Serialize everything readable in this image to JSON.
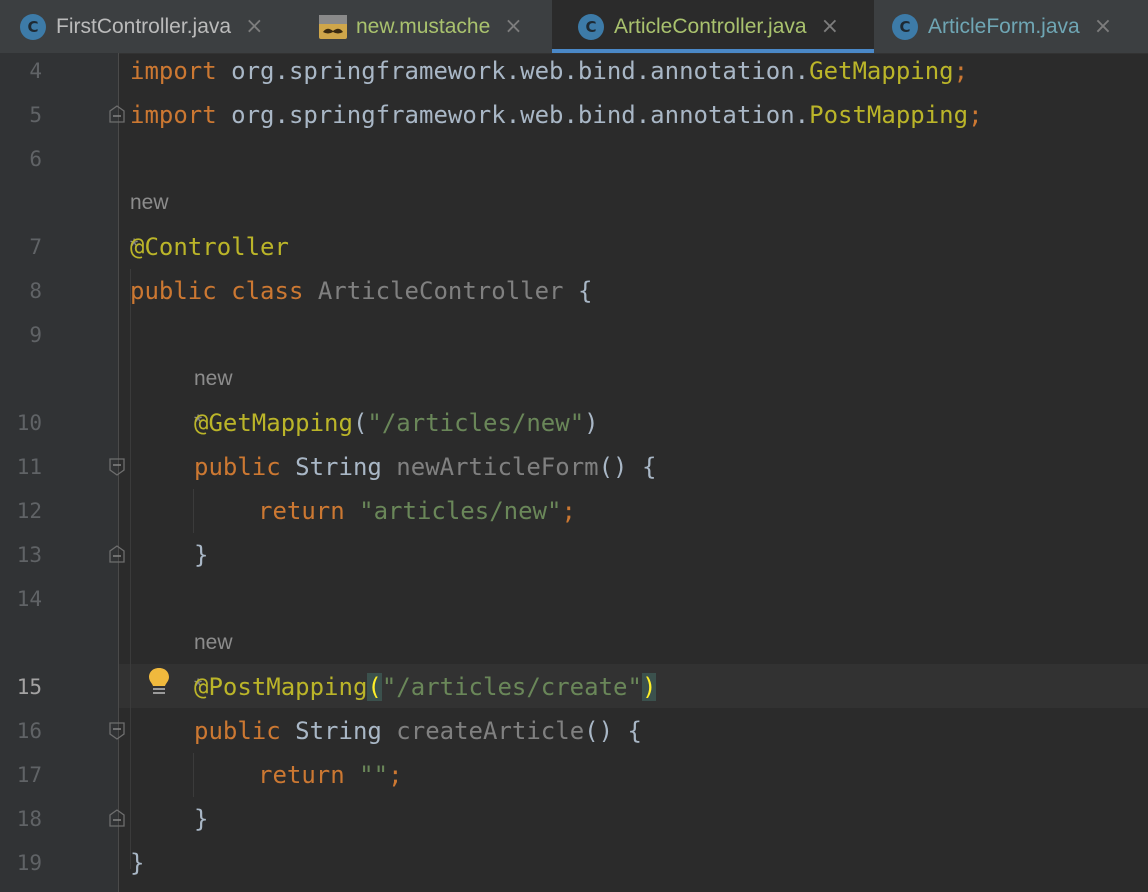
{
  "tabs": [
    {
      "label": "FirstController.java",
      "icon": "class-icon",
      "active": false
    },
    {
      "label": "new.mustache",
      "icon": "mustache-icon",
      "active": false
    },
    {
      "label": "ArticleController.java",
      "icon": "class-icon",
      "active": true
    },
    {
      "label": "ArticleForm.java",
      "icon": "class-icon",
      "active": false
    }
  ],
  "tab_class_glyph": "C",
  "tab_close_glyph": "×",
  "line_numbers": [
    "4",
    "5",
    "6",
    "7",
    "8",
    "9",
    "10",
    "11",
    "12",
    "13",
    "14",
    "15",
    "16",
    "17",
    "18",
    "19"
  ],
  "current_line": "15",
  "code": {
    "l4": {
      "kw": "import",
      "pkg": " org.springframework.web.bind.annotation.",
      "cls": "GetMapping",
      "end": ";"
    },
    "l5": {
      "kw": "import",
      "pkg": " org.springframework.web.bind.annotation.",
      "cls": "PostMapping",
      "end": ";"
    },
    "hint1": "new *",
    "l7": {
      "ann": "@Controller"
    },
    "l8": {
      "kw1": "public",
      "kw2": " class ",
      "name": "ArticleController",
      "brace": " {"
    },
    "hint2": "new *",
    "l10": {
      "ann": "@GetMapping",
      "open": "(",
      "str": "\"/articles/new\"",
      "close": ")"
    },
    "l11": {
      "kw": "public",
      "type": " String ",
      "name": "newArticleForm",
      "rest": "() {"
    },
    "l12": {
      "kw": "return",
      "str": " \"articles/new\"",
      "end": ";"
    },
    "l13": {
      "brace": "}"
    },
    "hint3": "new *",
    "l15": {
      "ann": "@PostMapping",
      "open": "(",
      "str": "\"/articles/create\"",
      "close": ")"
    },
    "l16": {
      "kw": "public",
      "type": " String ",
      "name": "createArticle",
      "rest": "() {"
    },
    "l17": {
      "kw": "return",
      "str": " \"\"",
      "end": ";"
    },
    "l18": {
      "brace": "}"
    },
    "l19": {
      "brace": "}"
    }
  },
  "colors": {
    "keyword": "#cc7832",
    "annotation": "#bbb529",
    "string": "#6a8759",
    "text": "#a9b7c6",
    "background": "#2b2b2b",
    "accent": "#4a88c7"
  }
}
